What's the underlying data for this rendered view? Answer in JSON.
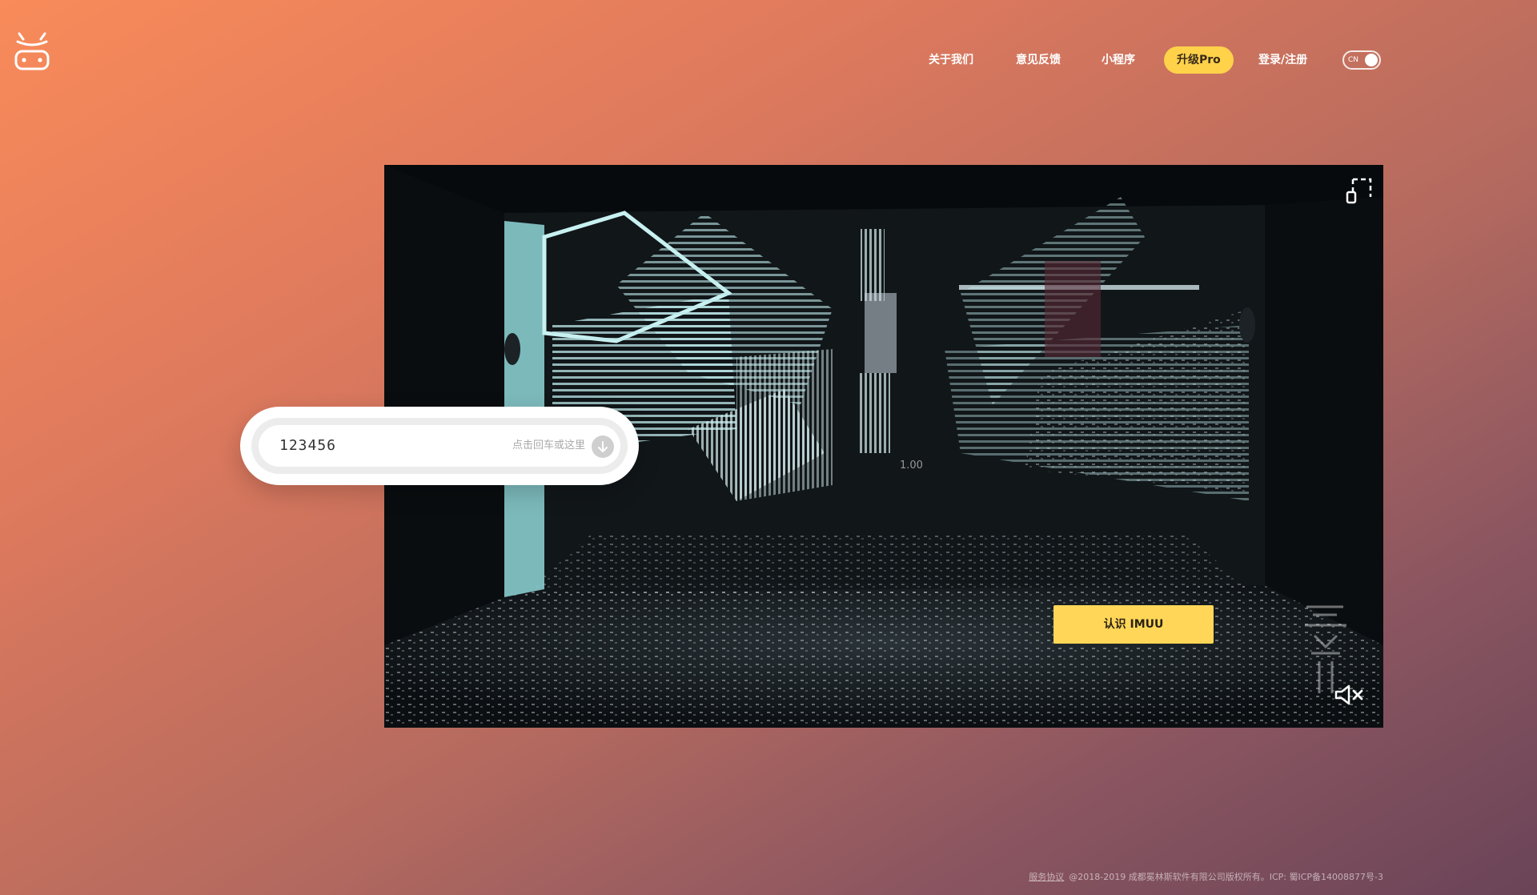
{
  "nav": {
    "about": "关于我们",
    "feedback": "意见反馈",
    "mini_program": "小程序",
    "upgrade": "升级Pro",
    "login": "登录/注册",
    "lang": "CN"
  },
  "video": {
    "speed": "1.00",
    "cta": "认识 IMUU"
  },
  "search": {
    "value": "123456",
    "hint": "点击回车或这里"
  },
  "footer": {
    "terms_link": "服务协议",
    "copyright": "@2018-2019 成都冕林斯软件有限公司版权所有。ICP: 蜀ICP备14008877号-3"
  },
  "colors": {
    "accent": "#ffd24a",
    "cta": "#ffd658",
    "bg_start": "#f98b5a",
    "bg_end": "#6a4458"
  },
  "icons": {
    "logo": "imuu-robot-logo",
    "fullscreen": "fullscreen-icon",
    "mute": "mute-icon",
    "submit": "arrow-down-icon"
  }
}
